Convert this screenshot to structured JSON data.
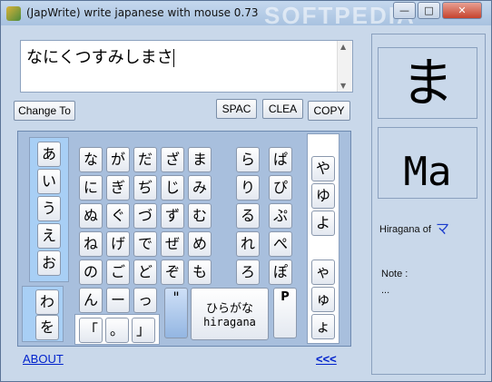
{
  "window": {
    "title": "(JapWrite) write japanese with mouse 0.73",
    "watermark": "SOFTPEDIA",
    "controls": {
      "minimize": "—",
      "maximize": "□",
      "close": "✕"
    }
  },
  "editor": {
    "text": "なにくつすみしまさ"
  },
  "buttons": {
    "change_to": "Change To",
    "space": "SPAC",
    "clear": "CLEA",
    "copy": "COPY"
  },
  "vowels": [
    "あ",
    "い",
    "う",
    "え",
    "お"
  ],
  "wa_keys": [
    "わ",
    "を"
  ],
  "grid": {
    "row1": [
      "な",
      "が",
      "だ",
      "ざ",
      "ま"
    ],
    "row2": [
      "に",
      "ぎ",
      "ぢ",
      "じ",
      "み"
    ],
    "row3": [
      "ぬ",
      "ぐ",
      "づ",
      "ず",
      "む"
    ],
    "row4": [
      "ね",
      "げ",
      "で",
      "ぜ",
      "め"
    ],
    "row5": [
      "の",
      "ご",
      "ど",
      "ぞ",
      "も"
    ],
    "row6": [
      "ん",
      "ー",
      "っ"
    ]
  },
  "r_keys": [
    "ら",
    "り",
    "る",
    "れ",
    "ろ"
  ],
  "p_keys": [
    "ぱ",
    "ぴ",
    "ぷ",
    "ぺ",
    "ぽ"
  ],
  "ya_big": [
    "や",
    "ゆ",
    "よ"
  ],
  "ya_small": [
    "ゃ",
    "ゅ",
    "ょ"
  ],
  "punct": [
    "「",
    "。",
    "」"
  ],
  "dakuten": "\"",
  "handakuten": "P",
  "mode_button": {
    "line1": "ひらがな",
    "line2": "hiragana"
  },
  "links": {
    "about": "ABOUT",
    "back": "<<<"
  },
  "preview": {
    "kana": "ま",
    "romaji": "Ma",
    "hiragana_of_label": "Hiragana of",
    "hiragana_of_value": "マ",
    "note_label": "Note :",
    "note_value": "..."
  }
}
